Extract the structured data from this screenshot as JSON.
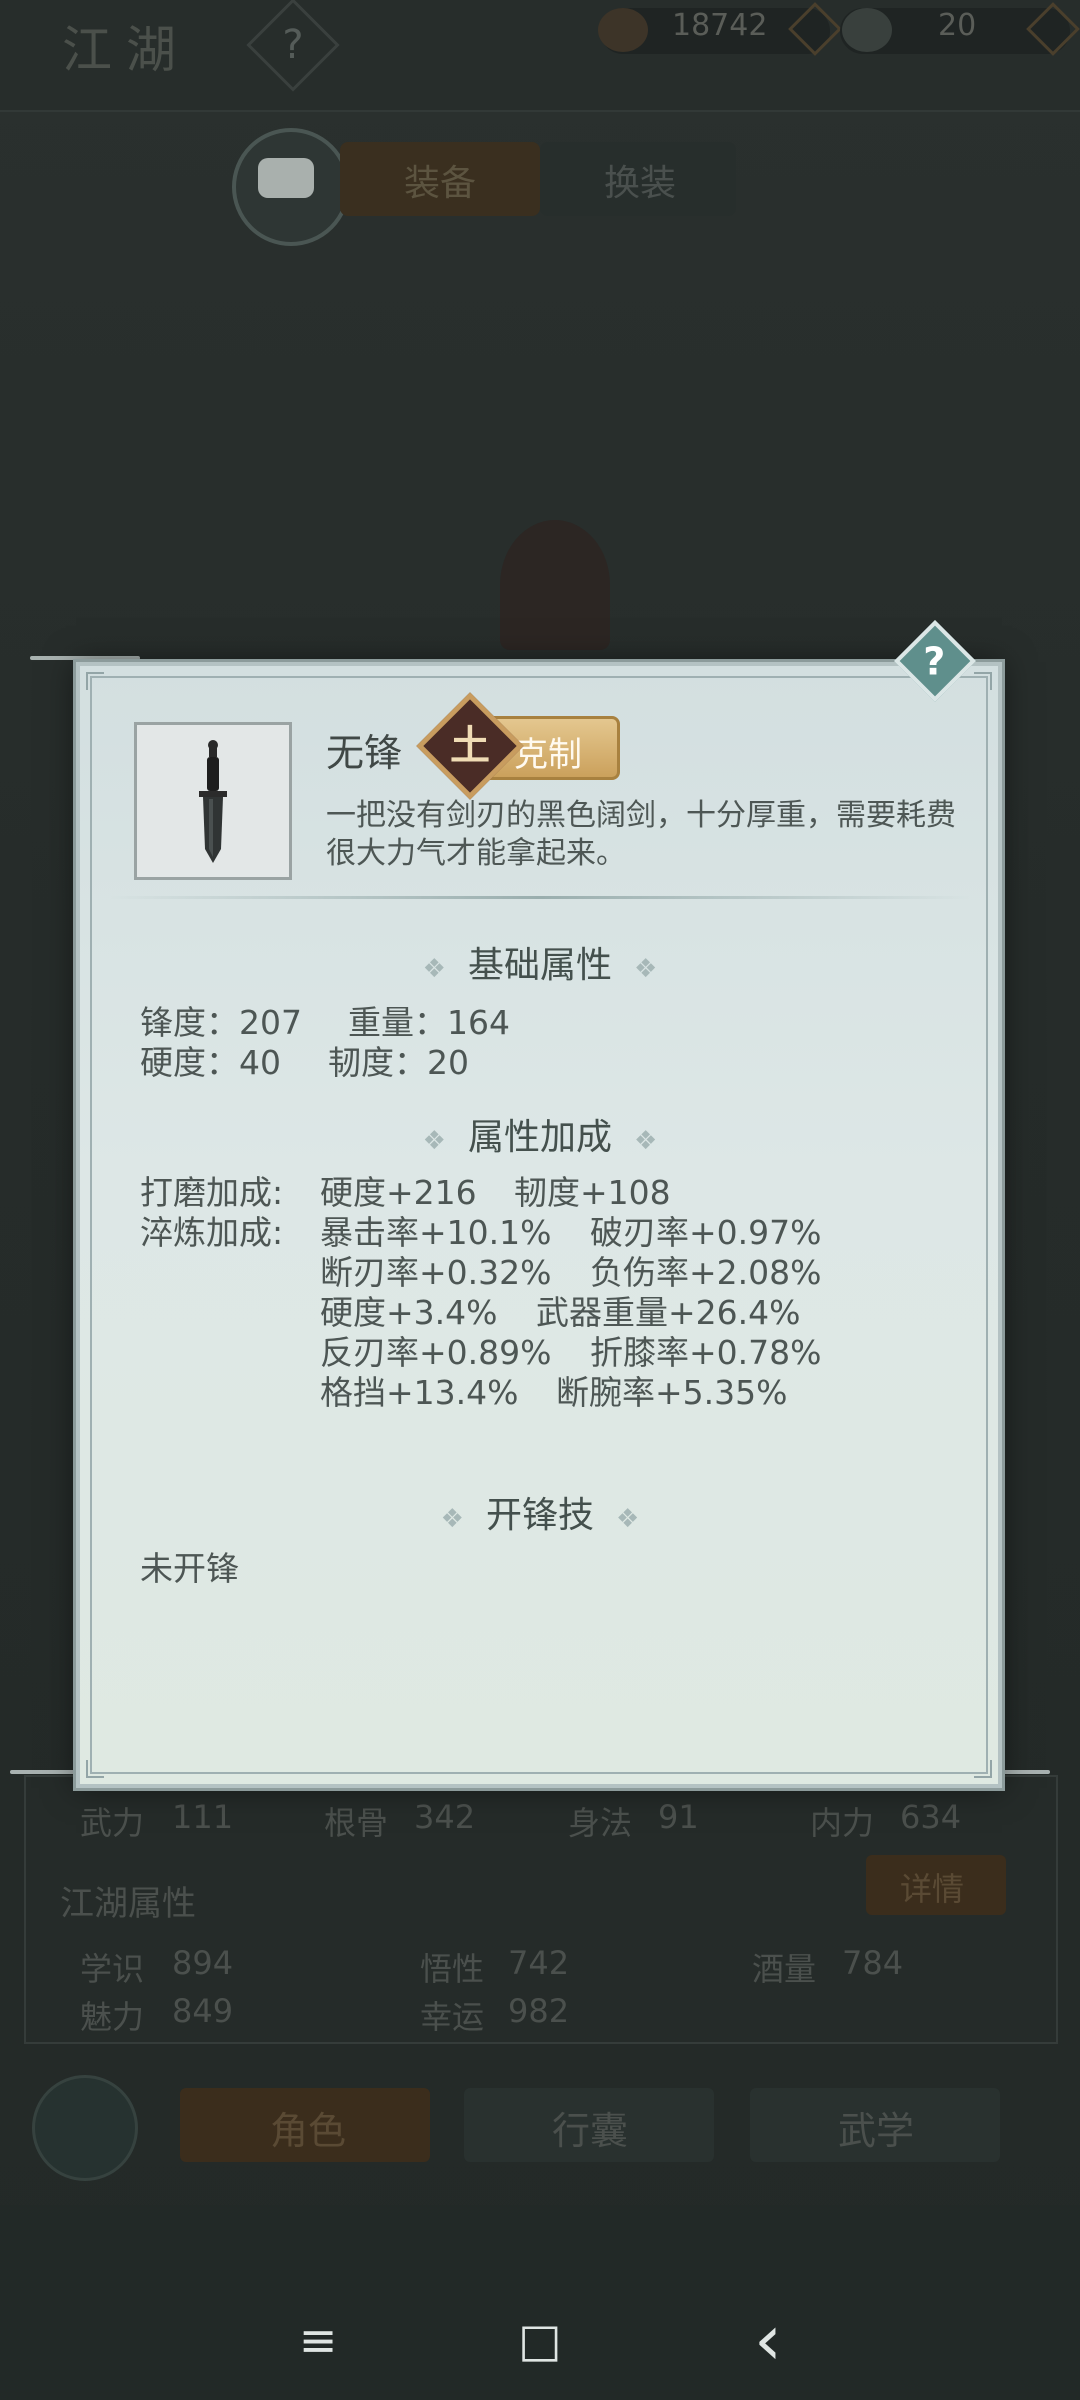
{
  "background": {
    "title": "江湖",
    "currency_coins": "18742",
    "currency_ingots": "20",
    "tabs": [
      "装备",
      "换装"
    ],
    "basic_stats": [
      {
        "label": "武力",
        "value": "111"
      },
      {
        "label": "根骨",
        "value": "342"
      },
      {
        "label": "身法",
        "value": "91"
      },
      {
        "label": "内力",
        "value": "634"
      }
    ],
    "jianghu_title": "江湖属性",
    "detail_button": "详情",
    "jianghu_stats": [
      {
        "label": "学识",
        "value": "894"
      },
      {
        "label": "悟性",
        "value": "742"
      },
      {
        "label": "酒量",
        "value": "784"
      },
      {
        "label": "魅力",
        "value": "849"
      },
      {
        "label": "幸运",
        "value": "982"
      }
    ],
    "nav_buttons": [
      "角色",
      "行囊",
      "武学"
    ]
  },
  "modal": {
    "help_icon": "?",
    "item": {
      "name": "无锋",
      "element_glyph": "土",
      "counter_label": "克制",
      "description": "一把没有剑刃的黑色阔剑，十分厚重，需要耗费很大力气才能拿起来。"
    },
    "basic_section": {
      "title": "基础属性",
      "rows": [
        [
          "锋度：207",
          "重量：164"
        ],
        [
          "硬度：40",
          "韧度：20"
        ]
      ]
    },
    "bonus_section": {
      "title": "属性加成",
      "grind_label": "打磨加成:",
      "grind_values": [
        "硬度+216",
        "韧度+108"
      ],
      "temper_label": "淬炼加成:",
      "temper_rows": [
        [
          "暴击率+10.1%",
          "破刃率+0.97%"
        ],
        [
          "断刃率+0.32%",
          "负伤率+2.08%"
        ],
        [
          "硬度+3.4%",
          "武器重量+26.4%"
        ],
        [
          "反刃率+0.89%",
          "折膝率+0.78%"
        ],
        [
          "格挡+13.4%",
          "断腕率+5.35%"
        ]
      ]
    },
    "skill_section": {
      "title": "开锋技",
      "value": "未开锋"
    }
  },
  "system_nav": {
    "menu_icon": "≡",
    "home_icon": "□",
    "back_icon": "‹"
  },
  "colors": {
    "modal_bg": "#dde7e6",
    "accent_gold": "#cba15c",
    "help_teal": "#5f8f8c",
    "text": "#4d5654"
  }
}
